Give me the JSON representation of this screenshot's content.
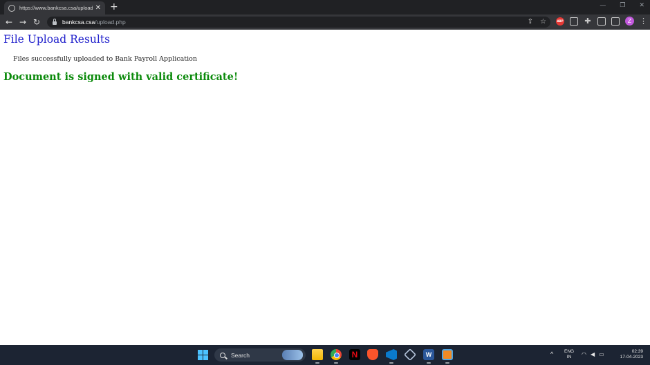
{
  "browser": {
    "tab": {
      "title": "https://www.bankcsa.csa/upload",
      "close_glyph": "✕"
    },
    "new_tab_glyph": "+",
    "window_controls": {
      "minimize": "—",
      "restore": "❐",
      "close": "✕"
    },
    "nav": {
      "back": "←",
      "forward": "→",
      "reload": "↻"
    },
    "address": {
      "host": "bankcsa.csa",
      "path": "/upload.php"
    },
    "omnibox_icons": {
      "share": "⇪",
      "bookmark": "☆"
    },
    "extensions": {
      "abp_label": "ABP",
      "puzzle": "✚",
      "menu": "⋮"
    },
    "profile_initial": "Z",
    "colors": {
      "frame": "#202124",
      "toolbar": "#35363a",
      "avatar": "#c158dc"
    }
  },
  "page": {
    "title": "File Upload Results",
    "message": "Files successfully uploaded to Bank Payroll Application",
    "status": "Document is signed with valid certificate!",
    "colors": {
      "title": "#2020cc",
      "status": "#0b8a0b"
    }
  },
  "taskbar": {
    "search_label": "Search",
    "apps": [
      "file-explorer",
      "chrome",
      "netflix",
      "brave",
      "vscode",
      "virtualbox",
      "word",
      "other-app"
    ],
    "netflix_letter": "N",
    "word_letter": "W",
    "tray": {
      "chevron": "^",
      "lang_line1": "ENG",
      "lang_line2": "IN",
      "icons": {
        "wifi": "◠",
        "volume": "◀",
        "battery": "▭"
      },
      "time": "02:39",
      "date": "17-04-2023"
    },
    "colors": {
      "background": "#1c2433",
      "start": "#4cc2ff"
    }
  }
}
